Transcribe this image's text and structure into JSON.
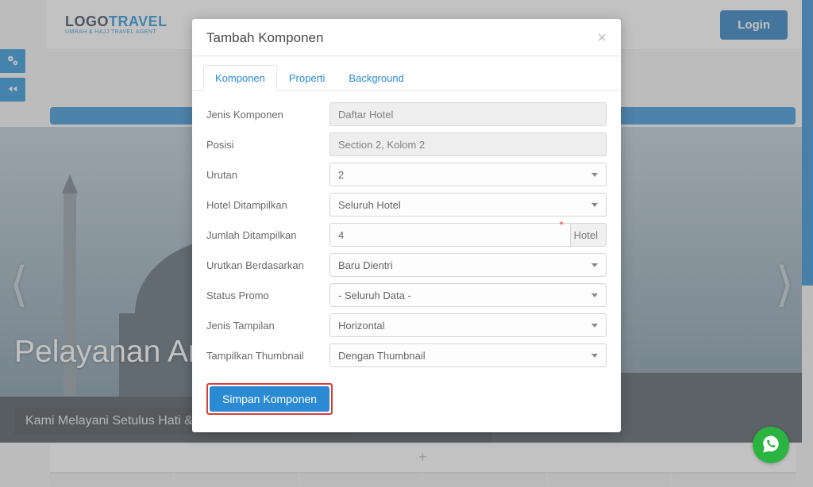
{
  "topbar": {
    "logo_main_dark": "LOGO",
    "logo_main_blue": "TRAVEL",
    "logo_sub": "UMRAH & HAJJ TRAVEL AGENT",
    "login_label": "Login"
  },
  "hero": {
    "title_visible": "Pelayanan Ar",
    "subtitle": "Kami Melayani Setulus Hati & Memberikan Yang Terbaik"
  },
  "modal": {
    "title": "Tambah Komponen",
    "tabs": {
      "komponen": "Komponen",
      "properti": "Properti",
      "background": "Background"
    },
    "labels": {
      "jenis_komponen": "Jenis Komponen",
      "posisi": "Posisi",
      "urutan": "Urutan",
      "hotel_ditampilkan": "Hotel Ditampilkan",
      "jumlah_ditampilkan": "Jumlah Ditampilkan",
      "urutkan_berdasarkan": "Urutkan Berdasarkan",
      "status_promo": "Status Promo",
      "jenis_tampilan": "Jenis Tampilan",
      "tampilkan_thumbnail": "Tampilkan Thumbnail"
    },
    "values": {
      "jenis_komponen": "Daftar Hotel",
      "posisi": "Section 2, Kolom 2",
      "urutan": "2",
      "hotel_ditampilkan": "Seluruh Hotel",
      "jumlah_ditampilkan": "4",
      "jumlah_unit": "Hotel",
      "urutkan_berdasarkan": "Baru Dientri",
      "status_promo": "- Seluruh Data -",
      "jenis_tampilan": "Horizontal",
      "tampilkan_thumbnail": "Dengan Thumbnail"
    },
    "save_label": "Simpan Komponen"
  }
}
